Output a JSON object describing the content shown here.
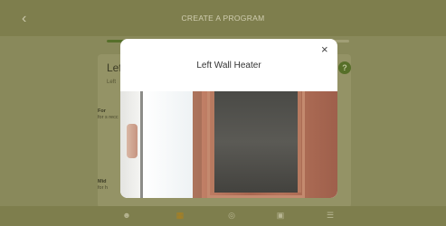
{
  "header": {
    "title": "CREATE A PROGRAM"
  },
  "progress": {
    "fraction": 0.09
  },
  "card": {
    "title": "Lef",
    "subtitle": "Left",
    "help_symbol": "?"
  },
  "sections": [
    {
      "heading": "For",
      "body": "for s recc"
    },
    {
      "heading": "Mid",
      "body": "for h"
    }
  ],
  "modal": {
    "title": "Left Wall Heater",
    "close_symbol": "×"
  },
  "icons": {
    "back": "chevron-left-icon",
    "close": "close-icon",
    "help": "help-icon"
  },
  "colors": {
    "accent_green": "#5c7a2e",
    "nav_active": "#c98f1a"
  }
}
